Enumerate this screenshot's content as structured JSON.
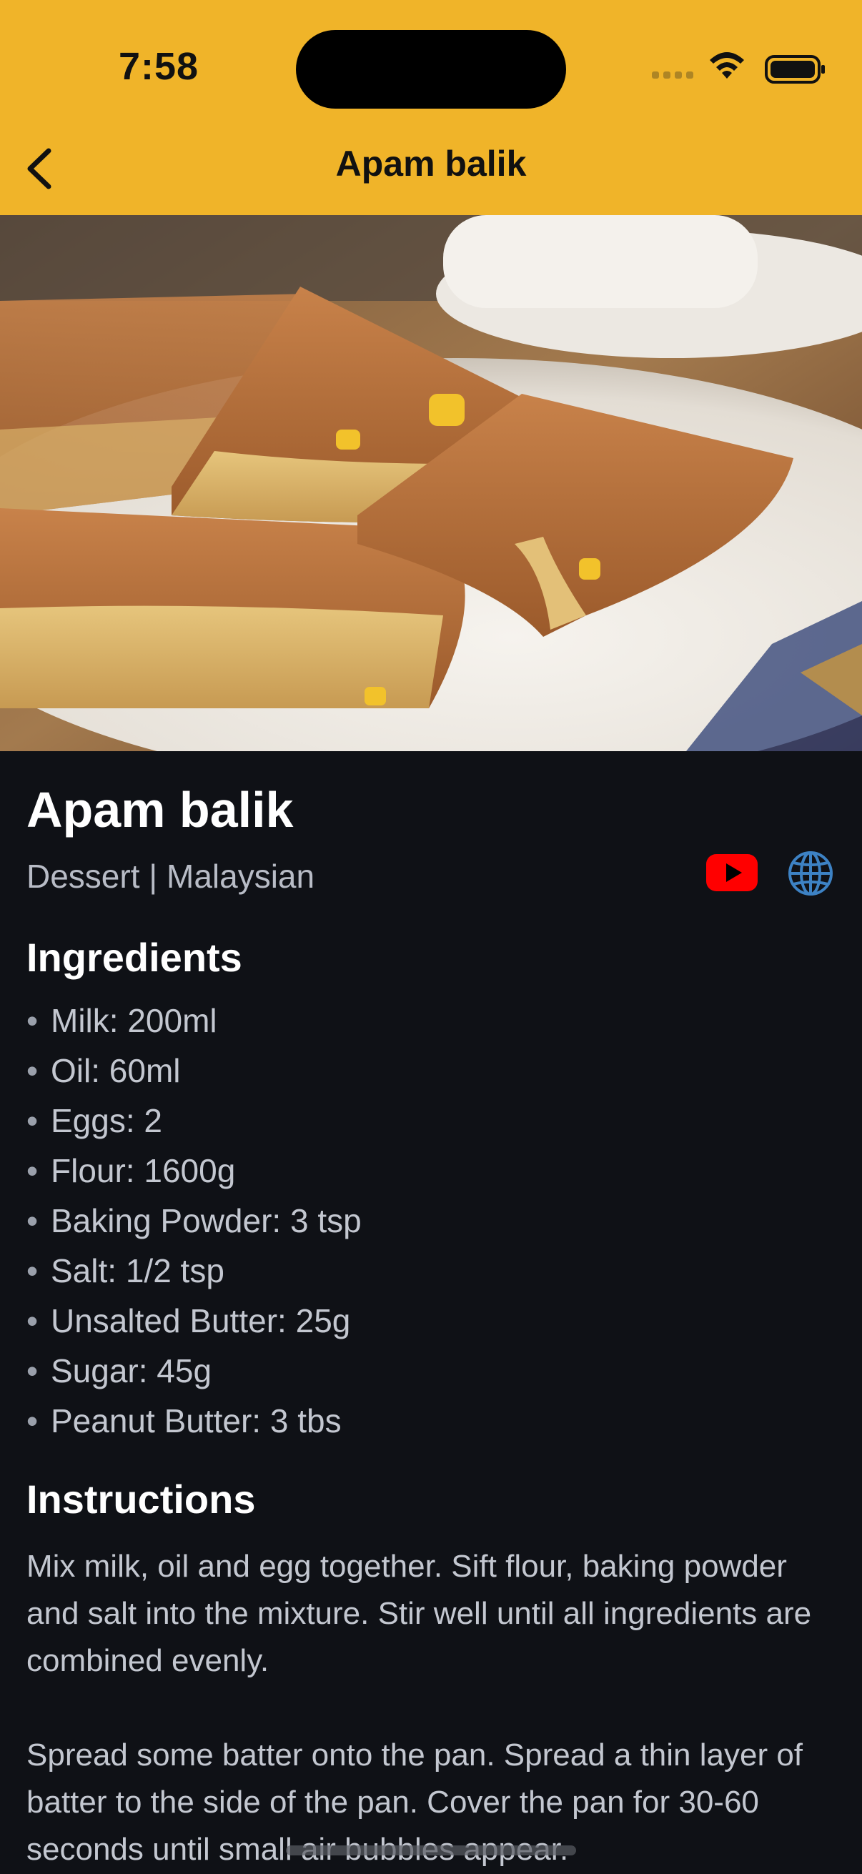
{
  "status_bar": {
    "time": "7:58"
  },
  "nav": {
    "title": "Apam balik",
    "back_icon": "chevron-left-icon"
  },
  "hero_image": {
    "alt": "Apam balik"
  },
  "recipe": {
    "title": "Apam balik",
    "meta": "Dessert | Malaysian",
    "links": {
      "youtube_icon": "youtube-icon",
      "web_icon": "globe-icon"
    }
  },
  "ingredients": {
    "heading": "Ingredients",
    "bullet": "•",
    "items": [
      "Milk: 200ml",
      "Oil: 60ml",
      "Eggs: 2",
      "Flour: 1600g",
      "Baking Powder: 3 tsp",
      "Salt: 1/2 tsp",
      "Unsalted Butter: 25g",
      "Sugar: 45g",
      "Peanut Butter: 3 tbs"
    ]
  },
  "instructions": {
    "heading": "Instructions",
    "paragraphs": [
      "Mix milk, oil and egg together. Sift flour, baking powder and salt into the mixture. Stir well until all ingredients are combined evenly.",
      "Spread some batter onto the pan. Spread a thin layer of batter to the side of the pan. Cover the pan for 30-60 seconds until small air bubbles appear."
    ]
  },
  "colors": {
    "header": "#f0b429",
    "background": "#0f1116",
    "youtube": "#ff0000",
    "globe": "#3d82c4"
  }
}
